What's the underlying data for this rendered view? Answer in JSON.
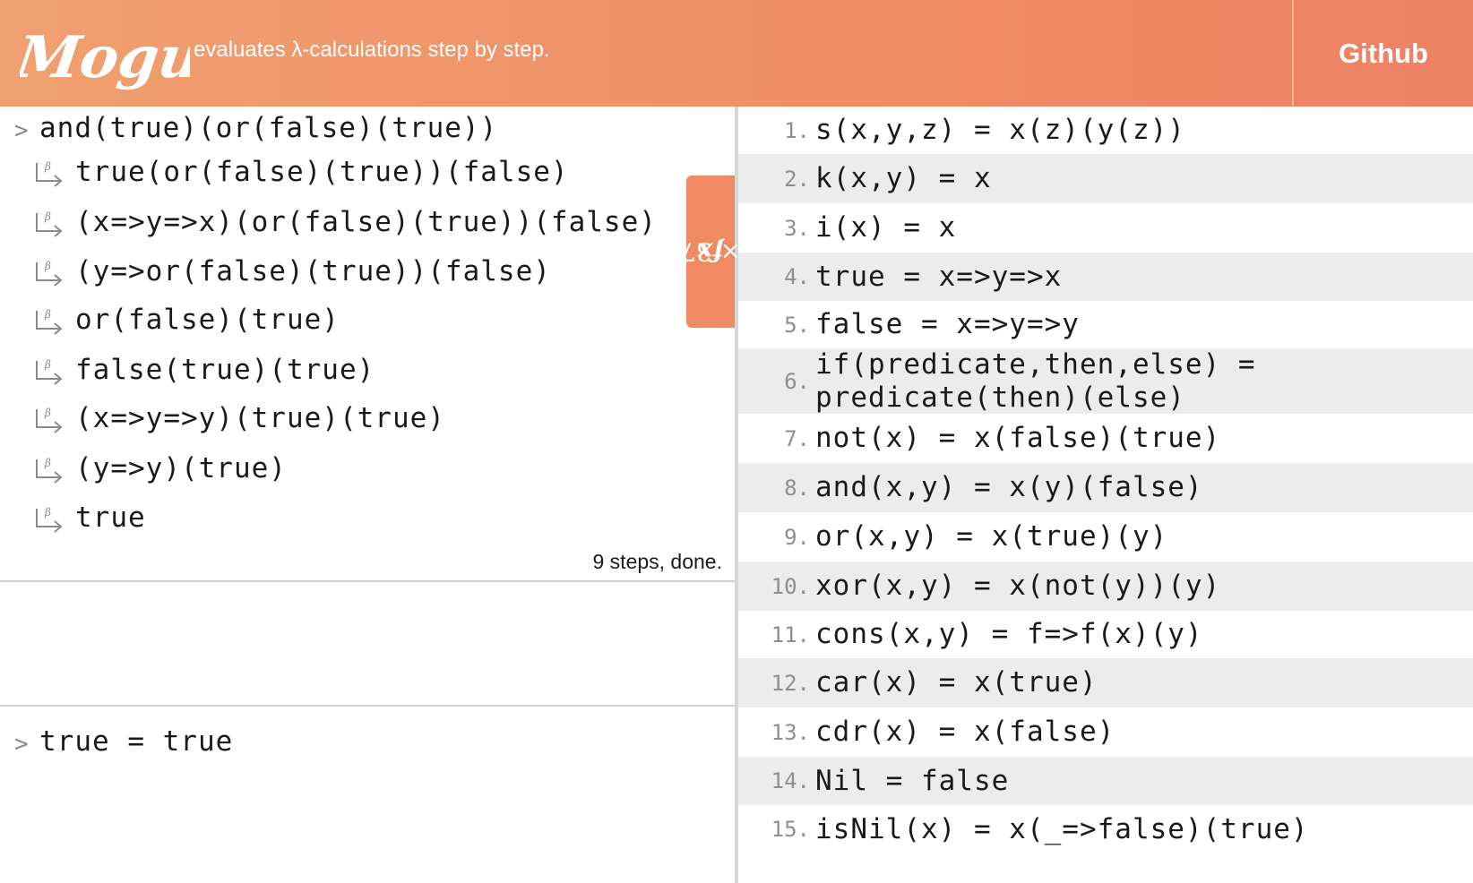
{
  "header": {
    "logo_text": "Mogul",
    "tagline": "evaluates λ-calculations step by step.",
    "github_label": "Github"
  },
  "evaluation": {
    "prompt_symbol": ">",
    "input": "and(true)(or(false)(true))",
    "step_marker": "β",
    "steps": [
      "true(or(false)(true))(false)",
      "(x=>y=>x)(or(false)(true))(false)",
      "(y=>or(false)(true))(false)",
      "or(false)(true)",
      "false(true)(true)",
      "(x=>y=>y)(true)(true)",
      "(y=>y)(true)",
      "true"
    ],
    "status": "9 steps, done."
  },
  "console": {
    "prompt_symbol": ">",
    "input": "true = true"
  },
  "definitions_tab": {
    "icon": "fx-icon",
    "label": "× 37"
  },
  "definitions": [
    {
      "num": "1.",
      "text": "s(x,y,z) = x(z)(y(z))"
    },
    {
      "num": "2.",
      "text": "k(x,y) = x"
    },
    {
      "num": "3.",
      "text": "i(x) = x"
    },
    {
      "num": "4.",
      "text": "true = x=>y=>x"
    },
    {
      "num": "5.",
      "text": "false = x=>y=>y"
    },
    {
      "num": "6.",
      "text": "if(predicate,then,else) =\npredicate(then)(else)"
    },
    {
      "num": "7.",
      "text": "not(x) = x(false)(true)"
    },
    {
      "num": "8.",
      "text": "and(x,y) = x(y)(false)"
    },
    {
      "num": "9.",
      "text": "or(x,y) = x(true)(y)"
    },
    {
      "num": "10.",
      "text": "xor(x,y) = x(not(y))(y)"
    },
    {
      "num": "11.",
      "text": "cons(x,y) = f=>f(x)(y)"
    },
    {
      "num": "12.",
      "text": "car(x) = x(true)"
    },
    {
      "num": "13.",
      "text": "cdr(x) = x(false)"
    },
    {
      "num": "14.",
      "text": "Nil = false"
    },
    {
      "num": "15.",
      "text": "isNil(x) = x(_=>false)(true)"
    }
  ],
  "colors": {
    "header_start": "#f0a070",
    "header_end": "#ee8063",
    "tab": "#ef8a62",
    "row_alt": "#ececec"
  }
}
